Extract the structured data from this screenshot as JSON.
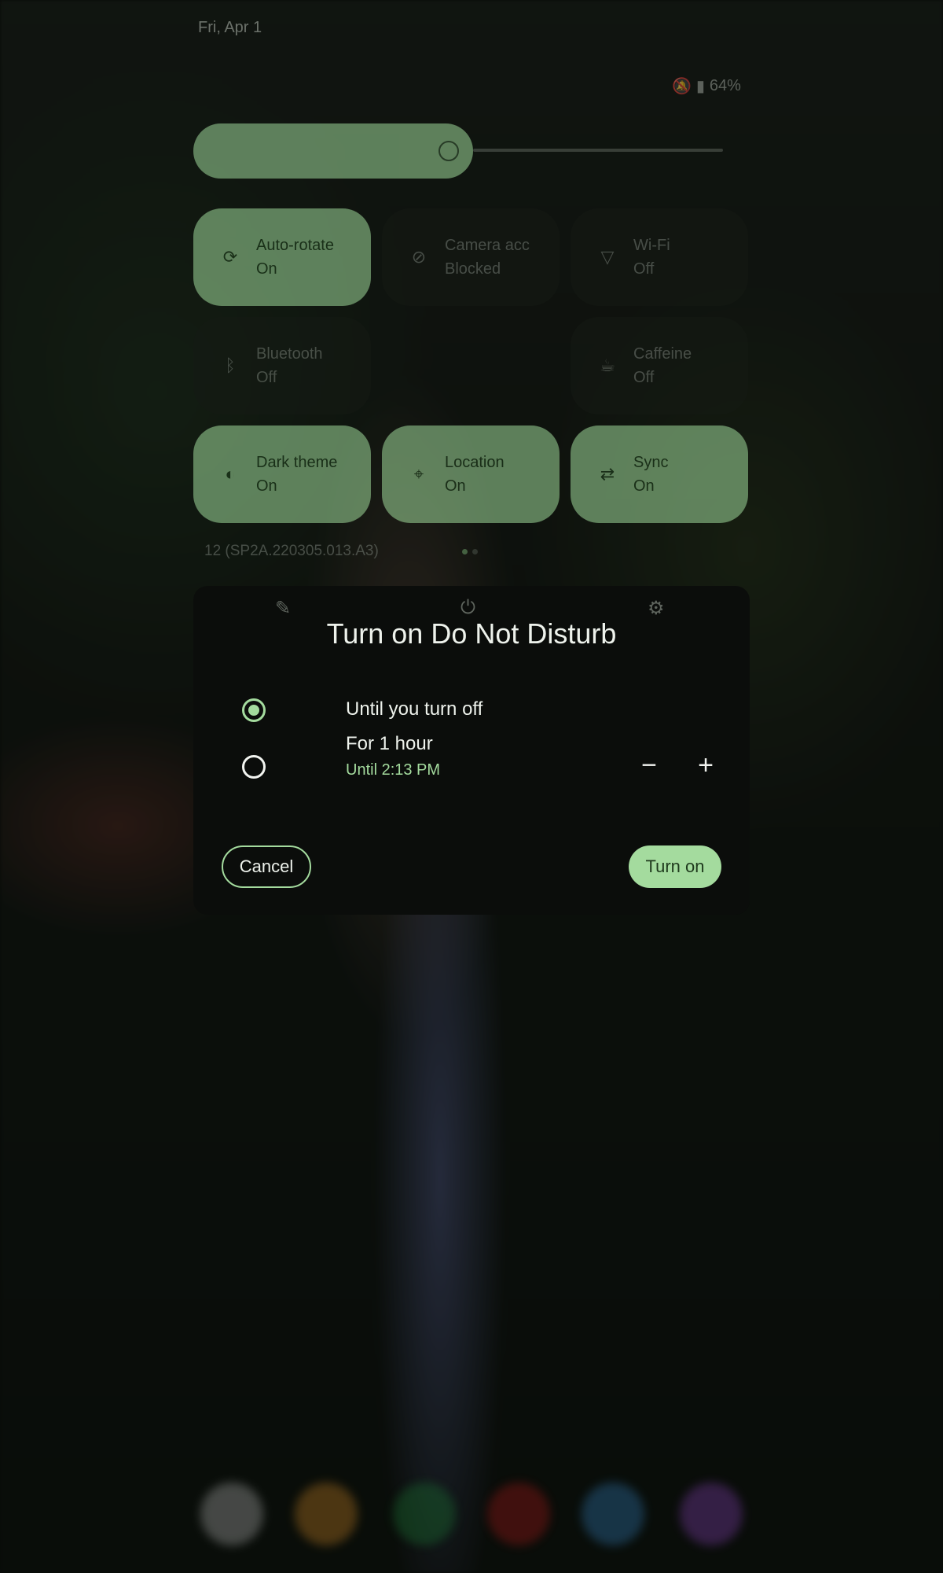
{
  "status_bar": {
    "date": "Fri, Apr 1",
    "battery": "64%",
    "icons": [
      "notifications-off-icon",
      "battery-icon"
    ]
  },
  "quick_settings": {
    "tiles": [
      {
        "label": "Auto-rotate",
        "state": "On",
        "icon": "auto-rotate-icon",
        "active": true
      },
      {
        "label": "Camera acc",
        "state": "Blocked",
        "icon": "camera-blocked-icon",
        "active": false
      },
      {
        "label": "Wi-Fi",
        "state": "Off",
        "icon": "wifi-icon",
        "active": false
      },
      {
        "label": "Bluetooth",
        "state": "Off",
        "icon": "bluetooth-icon",
        "active": false
      },
      {
        "label": "Caffeine",
        "state": "Off",
        "icon": "caffeine-icon",
        "active": false
      },
      {
        "label": "Dark theme",
        "state": "On",
        "icon": "dark-theme-icon",
        "active": true
      },
      {
        "label": "Location",
        "state": "On",
        "icon": "location-icon",
        "active": true
      },
      {
        "label": "Sync",
        "state": "On",
        "icon": "sync-icon",
        "active": true
      }
    ],
    "build_number": "12 (SP2A.220305.013.A3)",
    "footer_icons": [
      "edit-icon",
      "power-icon",
      "settings-icon"
    ]
  },
  "dialog": {
    "title": "Turn on Do Not Disturb",
    "options": [
      {
        "label": "Until you turn off",
        "checked": true
      },
      {
        "label": "For 1 hour",
        "sublabel": "Until 2:13 PM",
        "checked": false
      }
    ],
    "stepper": {
      "decrease": "−",
      "increase": "+"
    },
    "cancel_label": "Cancel",
    "confirm_label": "Turn on"
  },
  "colors": {
    "accent": "#a4db9e",
    "tile_on": "#9fd99a",
    "dialog_bg": "#0b0d0b"
  }
}
